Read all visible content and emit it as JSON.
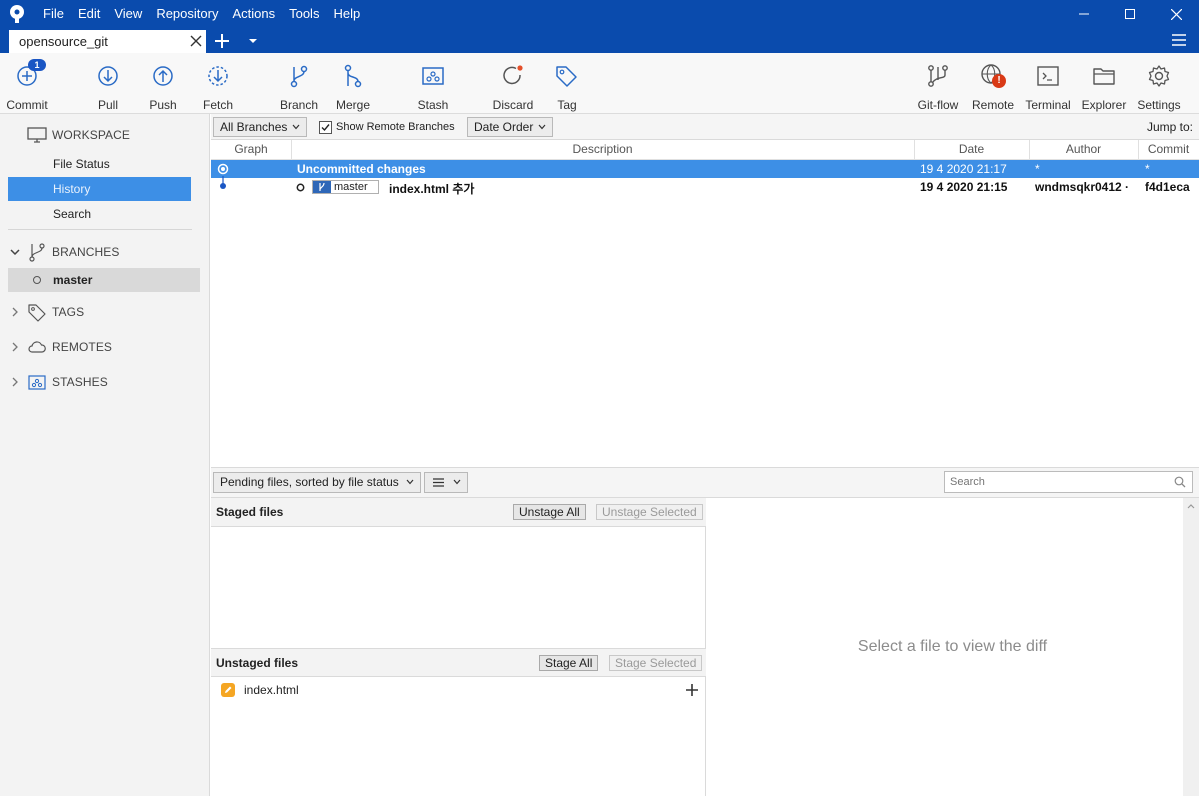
{
  "menu": [
    "File",
    "Edit",
    "View",
    "Repository",
    "Actions",
    "Tools",
    "Help"
  ],
  "tab": {
    "label": "opensource_git"
  },
  "toolbar": {
    "commit": "Commit",
    "commit_badge": "1",
    "pull": "Pull",
    "push": "Push",
    "fetch": "Fetch",
    "branch": "Branch",
    "merge": "Merge",
    "stash": "Stash",
    "discard": "Discard",
    "tag": "Tag",
    "gitflow": "Git-flow",
    "remote": "Remote",
    "remote_alert": "!",
    "terminal": "Terminal",
    "explorer": "Explorer",
    "settings": "Settings"
  },
  "sidebar": {
    "workspace": "WORKSPACE",
    "file_status": "File Status",
    "history": "History",
    "search": "Search",
    "branches": "BRANCHES",
    "master": "master",
    "tags": "TAGS",
    "remotes": "REMOTES",
    "stashes": "STASHES"
  },
  "filters": {
    "branches": "All Branches",
    "show_remote": "Show Remote Branches",
    "show_remote_checked": true,
    "order": "Date Order",
    "jump_to": "Jump to:"
  },
  "table": {
    "columns": [
      "Graph",
      "Description",
      "Date",
      "Author",
      "Commit"
    ],
    "rows": [
      {
        "description": "Uncommitted changes",
        "date": "19 4 2020 21:17",
        "author": "*",
        "commit": "*"
      },
      {
        "branch": "master",
        "description": "index.html 추가",
        "date": "19 4 2020 21:15",
        "author": "wndmsqkr0412 ·",
        "commit": "f4d1eca"
      }
    ]
  },
  "lower": {
    "sort": "Pending files, sorted by file status",
    "search_placeholder": "Search"
  },
  "staged": {
    "title": "Staged files",
    "unstage_all": "Unstage All",
    "unstage_selected": "Unstage Selected"
  },
  "unstaged": {
    "title": "Unstaged files",
    "stage_all": "Stage All",
    "stage_selected": "Stage Selected",
    "files": [
      {
        "name": "index.html",
        "status": "modified"
      }
    ]
  },
  "diff": {
    "placeholder": "Select a file to view the diff"
  },
  "colors": {
    "titlebar": "#0a4bad",
    "selection": "#3d8fe6",
    "accent": "#1a56c4",
    "modified": "#f5a623",
    "alert": "#d93a16"
  }
}
